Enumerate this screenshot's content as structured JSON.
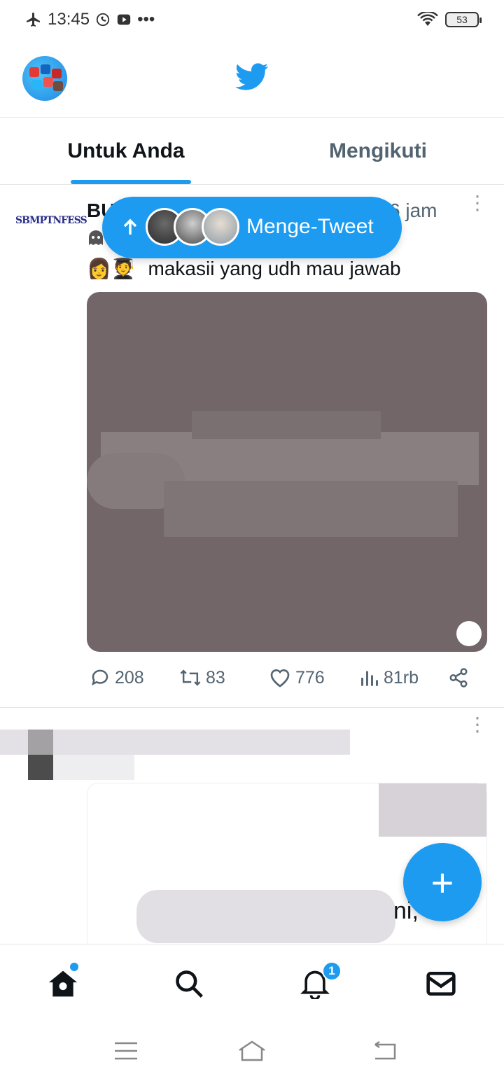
{
  "status_bar": {
    "time": "13:45",
    "battery": "53"
  },
  "tabs": {
    "for_you": "Untuk Anda",
    "following": "Mengikuti"
  },
  "tweet": {
    "name": "BU",
    "time": "6 jam",
    "text": "makasii yang udh mau jawab",
    "emoji": "👩🧑‍🎓",
    "avatar_text": "SBMPTNFESS",
    "stats": {
      "replies": "208",
      "retweets": "83",
      "likes": "776",
      "views": "81rb"
    }
  },
  "tweet2": {
    "fragment": "ni,"
  },
  "compose_pill": {
    "label": "Menge-Tweet"
  },
  "fab": {
    "label": "+"
  },
  "bottom_nav": {
    "notifications_badge": "1"
  },
  "colors": {
    "accent": "#1d9bf0",
    "muted": "#536471"
  }
}
